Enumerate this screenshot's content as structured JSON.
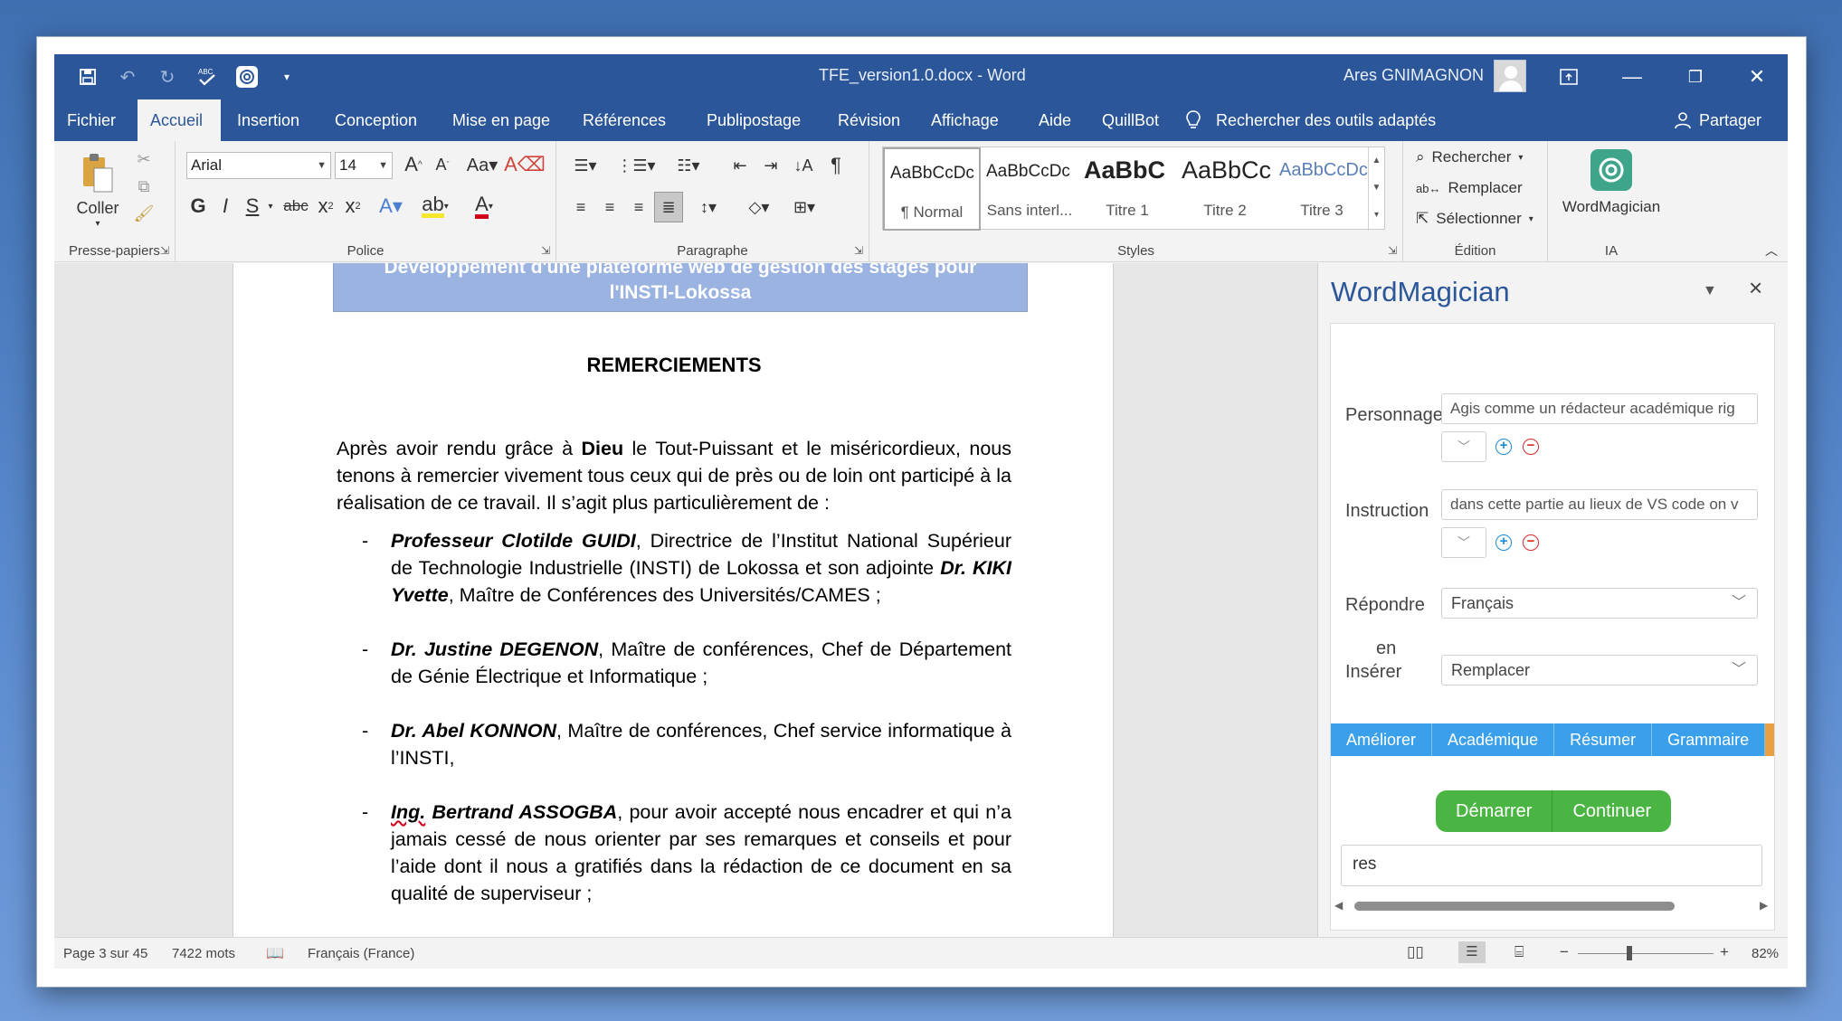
{
  "window": {
    "title": "TFE_version1.0.docx  -  Word",
    "user": "Ares GNIMAGNON"
  },
  "ribbon_tabs": [
    "Fichier",
    "Accueil",
    "Insertion",
    "Conception",
    "Mise en page",
    "Références",
    "Publipostage",
    "Révision",
    "Affichage",
    "Aide",
    "QuillBot"
  ],
  "active_tab": "Accueil",
  "tell_me": "Rechercher des outils adaptés",
  "share": "Partager",
  "clipboard": {
    "paste": "Coller",
    "label": "Presse-papiers"
  },
  "font": {
    "name": "Arial",
    "size": "14",
    "label": "Police"
  },
  "paragraph": {
    "label": "Paragraphe"
  },
  "styles": {
    "label": "Styles",
    "items": [
      {
        "sample": "AaBbCcDc",
        "name": "¶ Normal"
      },
      {
        "sample": "AaBbCcDc",
        "name": "Sans interl..."
      },
      {
        "sample": "AaBbC",
        "name": "Titre 1"
      },
      {
        "sample": "AaBbCc",
        "name": "Titre 2"
      },
      {
        "sample": "AaBbCcDc",
        "name": "Titre 3"
      }
    ]
  },
  "editing": {
    "find": "Rechercher",
    "replace": "Remplacer",
    "select": "Sélectionner",
    "label": "Édition"
  },
  "addin_group": {
    "button": "WordMagician",
    "label": "IA"
  },
  "document": {
    "header_line1": "Développement d'une plateforme web de gestion des stages pour",
    "header_line2": "l'INSTI-Lokossa",
    "heading": "REMERCIEMENTS",
    "intro_a": "Après avoir rendu grâce à ",
    "intro_bold": "Dieu",
    "intro_b": " le Tout-Puissant et le miséricordieux, nous tenons à remercier vivement tous ceux qui de près ou de loin ont participé à la réalisation de ce travail. Il s’agit plus particulièrement de :",
    "b1_name": "Professeur Clotilde GUIDI",
    "b1_text_a": ", Directrice de l’Institut National Supérieur de Technologie Industrielle (INSTI) de Lokossa et son adjointe ",
    "b1_name2": "Dr. KIKI Yvette",
    "b1_text_b": ", Maître de Conférences des Universités/CAMES ;",
    "b2_name": "Dr. Justine DEGENON",
    "b2_text": ", Maître de conférences, Chef de Département de Génie Électrique et Informatique ;",
    "b3_name": "Dr. Abel KONNON",
    "b3_text": ", Maître de conférences, Chef service informatique à l’INSTI,",
    "b4_name_a": "Ing.",
    "b4_name_b": " Bertrand ASSOGBA",
    "b4_text": ", pour avoir accepté nous encadrer et qui n’a jamais cessé de nous orienter par ses remarques et conseils et pour l’aide dont il nous a gratifiés dans la rédaction de ce document en sa qualité de superviseur ;",
    "dash": "-"
  },
  "pane": {
    "title": "WordMagician",
    "persona_label": "Personnage",
    "persona_value": "Agis comme un rédacteur académique rig",
    "instruction_label": "Instruction",
    "instruction_value": "dans cette partie au lieux de VS code on v",
    "respond_label": "Répondre",
    "respond_value": "Français",
    "insert_label_1": "en",
    "insert_label_2": "Insérer",
    "insert_value": "Remplacer",
    "actions": [
      "Améliorer",
      "Académique",
      "Résumer",
      "Grammaire"
    ],
    "start": "Démarrer",
    "continue": "Continuer",
    "output": "res"
  },
  "status": {
    "page": "Page 3 sur 45",
    "words": "7422 mots",
    "language": "Français (France)",
    "zoom_minus": "−",
    "zoom_plus": "+",
    "zoom": "82%"
  },
  "colors": {
    "title_bar": "#2b579a",
    "accent_blue": "#3ba0ec",
    "green": "#4bb543",
    "header_band": "#9bb3e0"
  }
}
